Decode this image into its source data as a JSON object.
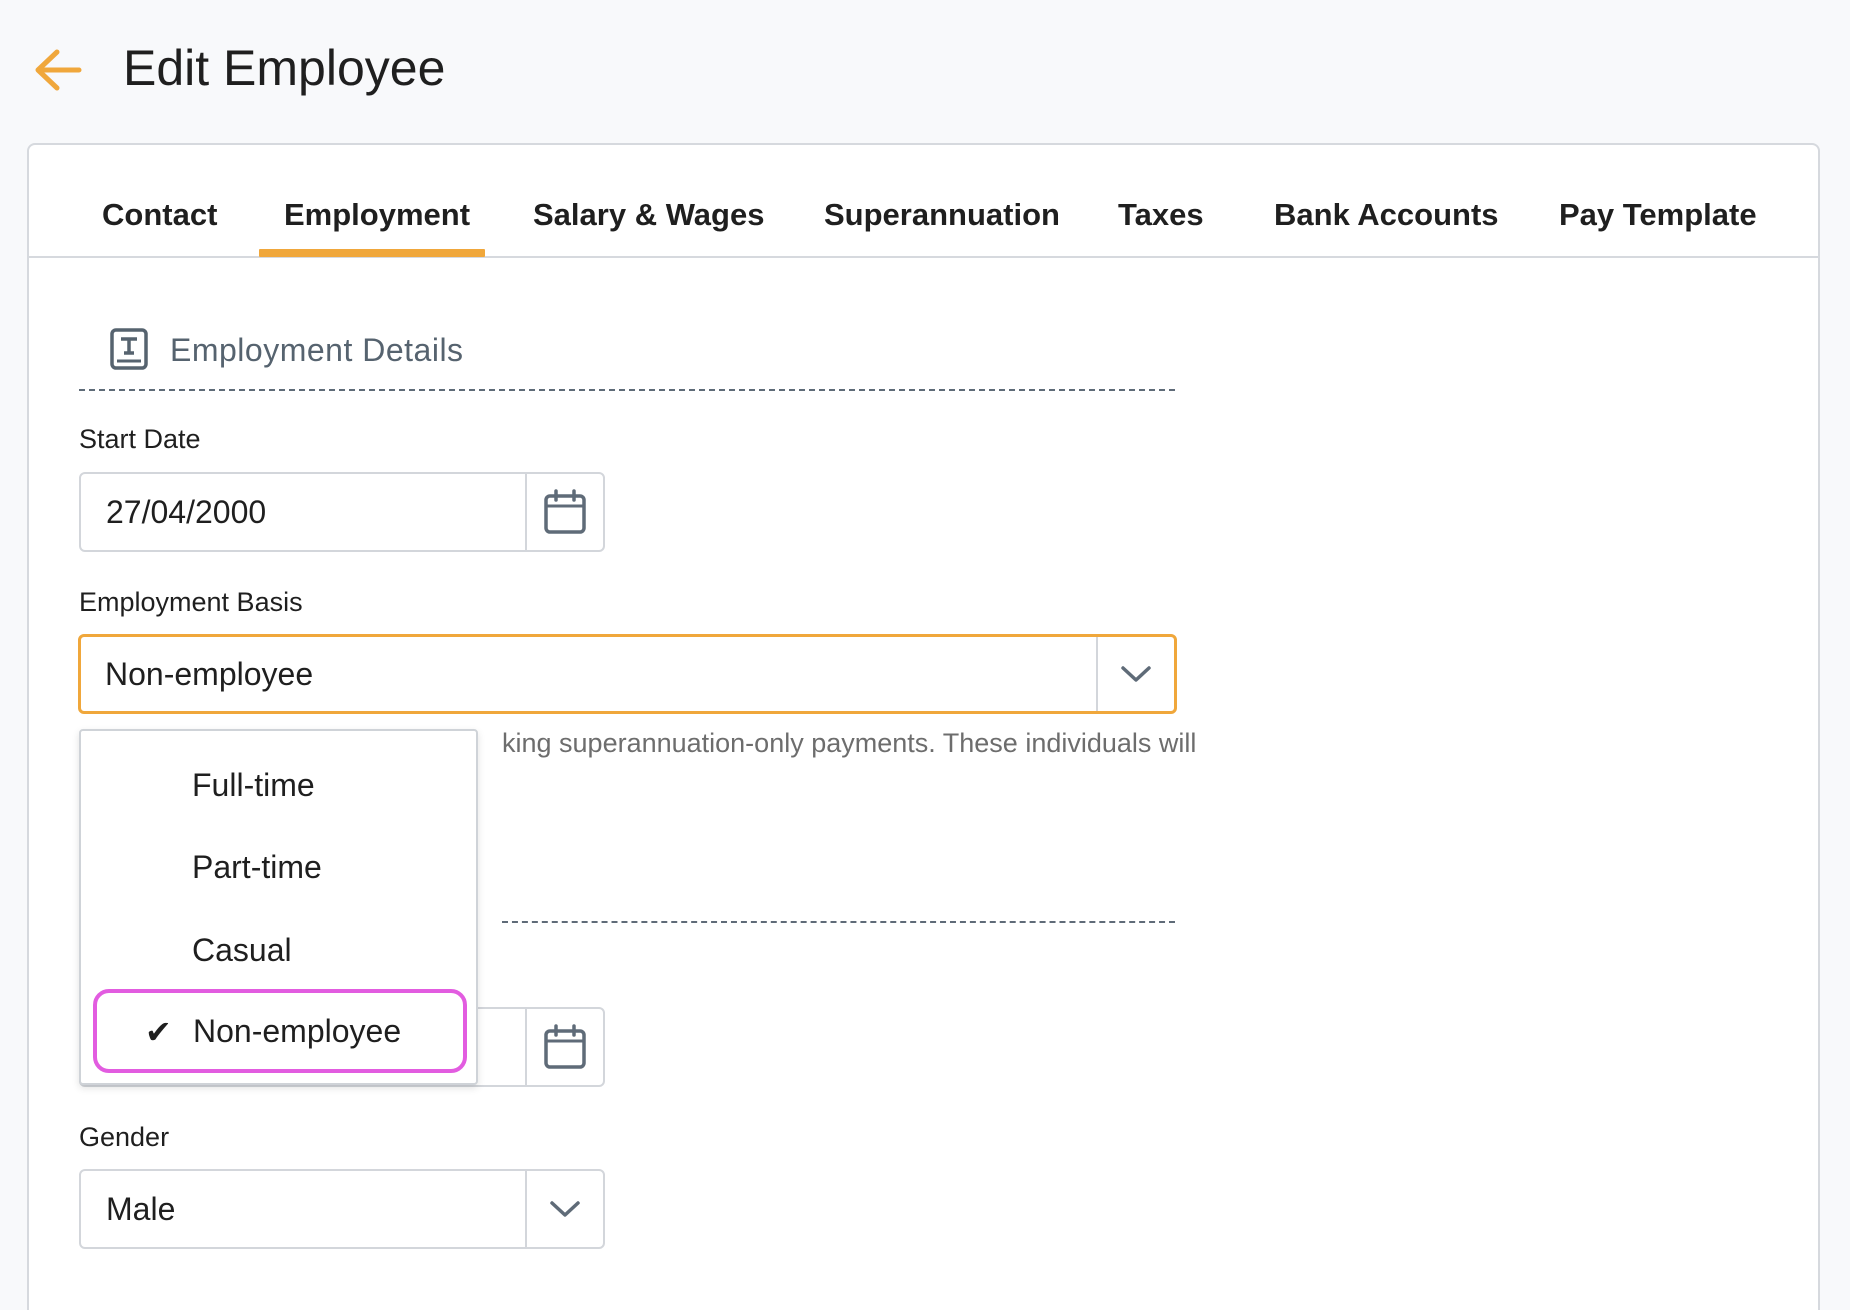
{
  "header": {
    "title": "Edit Employee",
    "back_icon": "arrow-left-icon",
    "accent_color": "#f0a73b"
  },
  "tabs": [
    {
      "label": "Contact",
      "active": false
    },
    {
      "label": "Employment",
      "active": true
    },
    {
      "label": "Salary & Wages",
      "active": false
    },
    {
      "label": "Superannuation",
      "active": false
    },
    {
      "label": "Taxes",
      "active": false
    },
    {
      "label": "Bank Accounts",
      "active": false
    },
    {
      "label": "Pay Template",
      "active": false
    }
  ],
  "section": {
    "title": "Employment Details",
    "icon": "contract-icon"
  },
  "fields": {
    "start_date": {
      "label": "Start Date",
      "value": "27/04/2000",
      "icon": "calendar-icon"
    },
    "employment_basis": {
      "label": "Employment Basis",
      "value": "Non-employee",
      "icon": "chevron-down-icon",
      "help_text": "king superannuation-only payments. These individuals will"
    },
    "second_date": {
      "icon": "calendar-icon"
    },
    "gender": {
      "label": "Gender",
      "value": "Male",
      "icon": "chevron-down-icon"
    }
  },
  "dropdown": {
    "options": [
      {
        "label": "Full-time",
        "selected": false
      },
      {
        "label": "Part-time",
        "selected": false
      },
      {
        "label": "Casual",
        "selected": false
      },
      {
        "label": "Non-employee",
        "selected": true
      }
    ],
    "check_glyph": "✔",
    "highlight_color": "#e25ce0"
  }
}
